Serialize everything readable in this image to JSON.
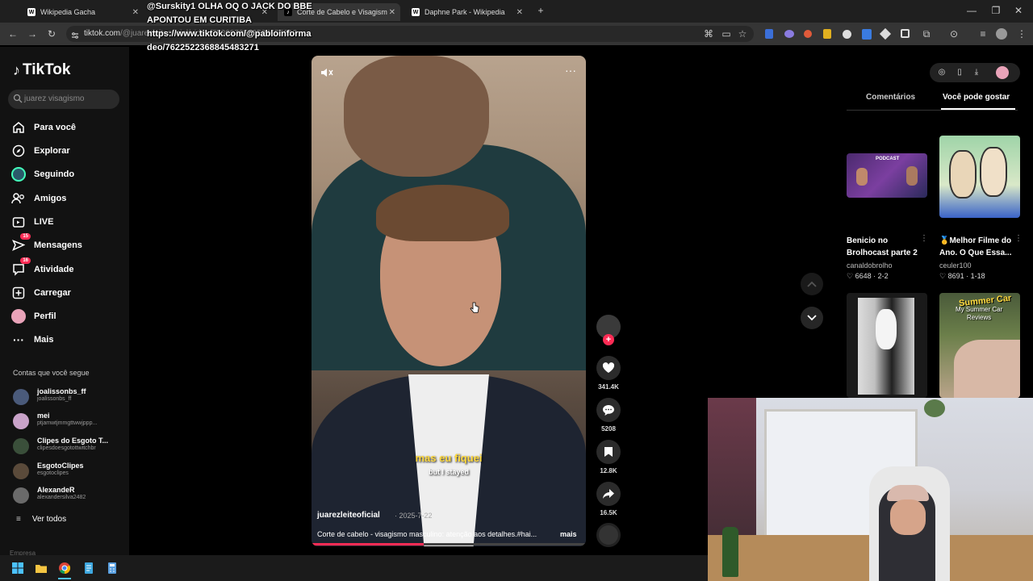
{
  "browser": {
    "tabs": [
      {
        "label": "Wikipedia Gacha",
        "favicon": "W"
      },
      {
        "label": "",
        "favicon": ""
      },
      {
        "label": "Corte de Cabelo e Visagism",
        "favicon": "tiktok"
      },
      {
        "label": "Daphne Park - Wikipedia",
        "favicon": "W"
      }
    ],
    "url_host": "tiktok.com",
    "url_path": "/@juarezleiteoficial/video/7530872559524655912"
  },
  "overlay_chat": {
    "line1": "@Surskity1 OLHA OQ O JACK DO BBE",
    "line2": "APONTOU EM CURITIBA",
    "line3": "https://www.tiktok.com/@pabloinforma",
    "line4": "deo/7622522368845483271"
  },
  "sidebar": {
    "logo": "TikTok",
    "search_placeholder": "juarez visagismo",
    "nav": [
      {
        "label": "Para você",
        "icon": "home-icon"
      },
      {
        "label": "Explorar",
        "icon": "compass-icon"
      },
      {
        "label": "Seguindo",
        "icon": "following-avatar-icon"
      },
      {
        "label": "Amigos",
        "icon": "friends-icon"
      },
      {
        "label": "LIVE",
        "icon": "live-icon"
      },
      {
        "label": "Mensagens",
        "icon": "message-icon",
        "badge": "15"
      },
      {
        "label": "Atividade",
        "icon": "activity-icon",
        "badge": "16"
      },
      {
        "label": "Carregar",
        "icon": "upload-icon"
      },
      {
        "label": "Perfil",
        "icon": "profile-avatar-icon"
      },
      {
        "label": "Mais",
        "icon": "more-dots-icon"
      }
    ],
    "following_title": "Contas que você segue",
    "following": [
      {
        "name": "joalissonbs_ff",
        "handle": "joalissonbs_ff",
        "color": "#4a5a7a"
      },
      {
        "name": "mei",
        "handle": "ptjamwtjmmgttwwjppp...",
        "color": "#c9a3c9"
      },
      {
        "name": "Clipes do Esgoto T...",
        "handle": "clipesdoesgotottwitchbr",
        "color": "#3a4f3a"
      },
      {
        "name": "EsgotoClipes",
        "handle": "esgotoclipes",
        "color": "#5a4a3a"
      },
      {
        "name": "AlexandeR",
        "handle": "alexandersilva2482",
        "color": "#6a6a6a"
      }
    ],
    "see_all": "Ver todos",
    "company": "Empresa"
  },
  "video": {
    "author": "juarezleiteoficial",
    "date": "· 2025-7-22",
    "description": "Corte de cabelo - visagismo masculino: atenção aos detalhes.#hai...",
    "more": "mais",
    "caption_pt": "mas eu fiquei",
    "caption_en": "but I stayed",
    "progress": 0.41,
    "likes": "341.4K",
    "comments": "5208",
    "saves": "12.8K",
    "shares": "16.5K"
  },
  "right_panel": {
    "tabs": [
      "Comentários",
      "Você pode gostar"
    ],
    "active_tab": "Você pode gostar",
    "cards": [
      {
        "title": "Benicio no Brolhocast parte 2",
        "user": "canaldobrolho",
        "likes": "6648",
        "date": "2-2",
        "thumb_text": "PODCAST"
      },
      {
        "title": "🥇Melhor Filme do Ano. O Que Essa...",
        "user": "ceuler100",
        "likes": "8691",
        "date": "1-18",
        "thumb_text": ""
      },
      {
        "title": "",
        "user": "",
        "likes": "",
        "date": "",
        "thumb_text": ""
      },
      {
        "title": "",
        "user": "",
        "likes": "",
        "date": "",
        "thumb_text": "Summer Car\nMy Summer Car\nReviews"
      }
    ],
    "card4_t1": "Summer Car",
    "card4_t2": "My Summer Car",
    "card4_t3": "Reviews"
  },
  "colors": {
    "accent": "#fe2c55",
    "caption_yellow": "#ffd93d",
    "sidebar_bg": "#121212"
  }
}
